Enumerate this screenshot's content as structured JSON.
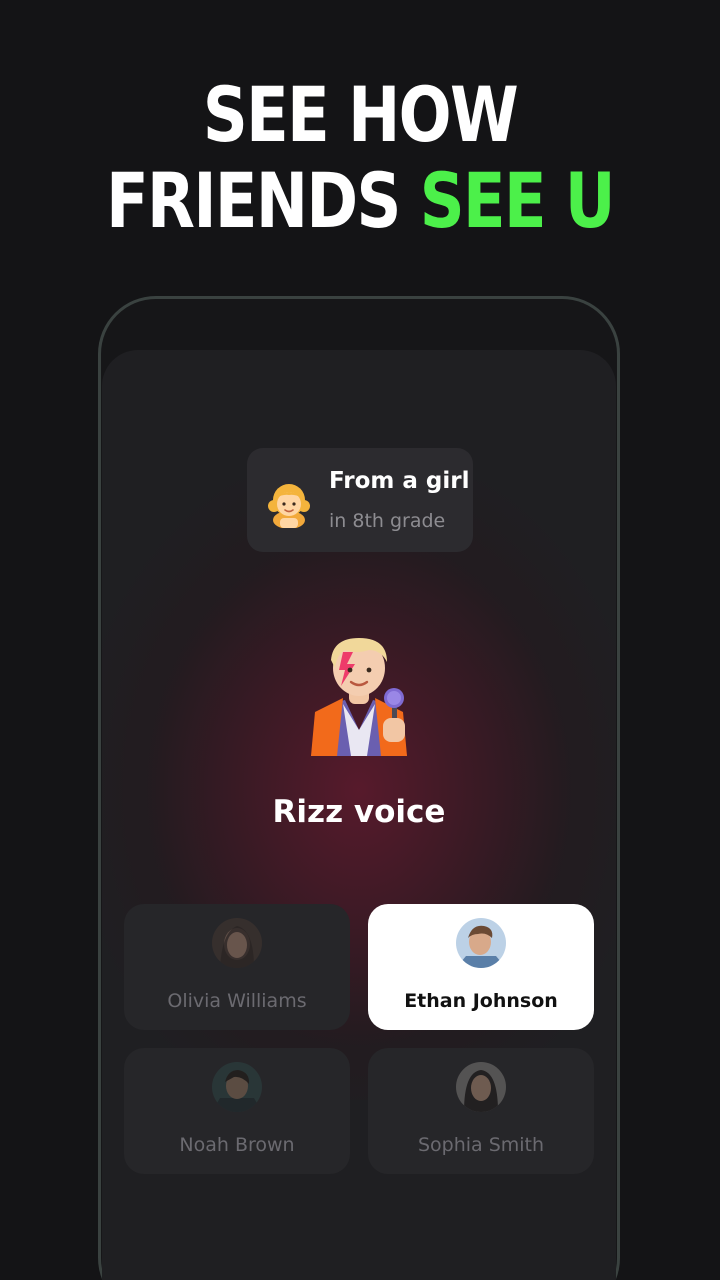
{
  "headline": {
    "line1": "SEE HOW",
    "line2_white": "FRIENDS",
    "line2_accent": "SEE U",
    "accent_color": "#4cf04a"
  },
  "sender": {
    "icon": "girl-emoji-icon",
    "title": "From a girl",
    "subtitle": "in 8th grade"
  },
  "poll": {
    "icon": "singer-with-microphone-emoji-icon",
    "question": "Rizz voice"
  },
  "options": [
    {
      "name": "Olivia Williams",
      "selected": false
    },
    {
      "name": "Ethan Johnson",
      "selected": true
    },
    {
      "name": "Noah Brown",
      "selected": false
    },
    {
      "name": "Sophia Smith",
      "selected": false
    }
  ]
}
